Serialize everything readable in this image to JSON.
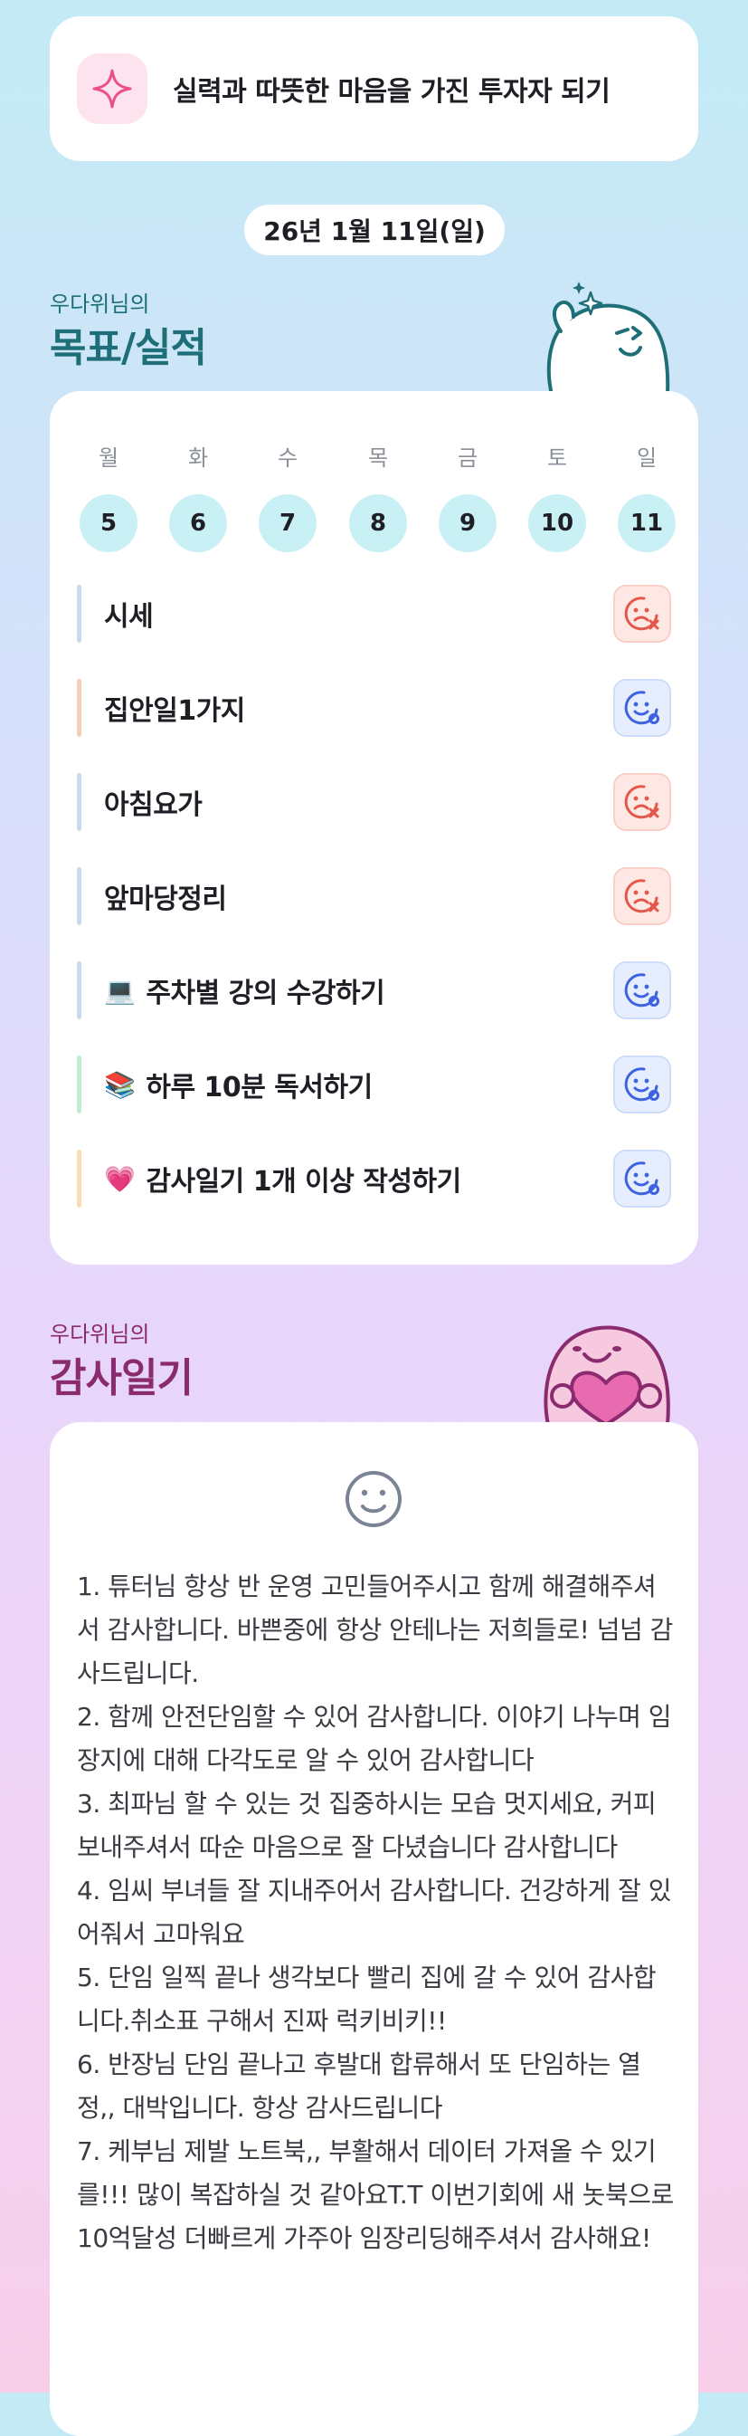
{
  "motto": {
    "icon": "sparkle-icon",
    "text": "실력과 따뜻한 마음을 가진 투자자 되기"
  },
  "date_label": "26년 1월 11일(일)",
  "goals_section": {
    "subtitle": "우다위님의",
    "title": "목표/실적",
    "weekdays": [
      "월",
      "화",
      "수",
      "목",
      "금",
      "토",
      "일"
    ],
    "days": [
      "5",
      "6",
      "7",
      "8",
      "9",
      "10",
      "11"
    ],
    "items": [
      {
        "label": "시세",
        "emoji": "",
        "status": "fail",
        "bar_color": "#c9d9ee"
      },
      {
        "label": "집안일1가지",
        "emoji": "",
        "status": "done",
        "bar_color": "#f6cdb8"
      },
      {
        "label": "아침요가",
        "emoji": "",
        "status": "fail",
        "bar_color": "#c9d9ee"
      },
      {
        "label": "앞마당정리",
        "emoji": "",
        "status": "fail",
        "bar_color": "#c9d9ee"
      },
      {
        "label": "주차별 강의 수강하기",
        "emoji": "💻",
        "status": "done",
        "bar_color": "#c9d9ee"
      },
      {
        "label": "하루 10분 독서하기",
        "emoji": "📚",
        "status": "done",
        "bar_color": "#bdeed4"
      },
      {
        "label": "감사일기 1개 이상 작성하기",
        "emoji": "💗",
        "status": "done",
        "bar_color": "#f9dcb6"
      }
    ]
  },
  "gratitude_section": {
    "subtitle": "우다위님의",
    "title": "감사일기",
    "icon": "smile-face-icon",
    "entries": [
      "1. 튜터님 항상 반 운영 고민들어주시고 함께 해결해주셔서 감사합니다. 바쁜중에 항상 안테나는 저희들로! 넘넘 감사드립니다.",
      "2. 함께 안전단임할 수 있어 감사합니다. 이야기 나누며 임장지에 대해 다각도로 알 수 있어 감사합니다",
      "3. 최파님 할 수 있는 것 집중하시는 모습 멋지세요, 커피보내주셔서 따순 마음으로 잘 다녔습니다 감사합니다",
      "4. 임씨 부녀들 잘 지내주어서 감사합니다. 건강하게 잘 있어줘서 고마워요",
      "5. 단임 일찍 끝나 생각보다 빨리 집에 갈 수 있어 감사합니다.취소표 구해서 진짜 럭키비키!!",
      "6. 반장님 단임 끝나고 후발대 합류해서 또 단임하는 열정,, 대박입니다. 항상 감사드립니다",
      "7. 케부님 제발 노트북,, 부활해서 데이터 가져올 수 있기를!!! 많이 복잡하실 것 같아요T.T 이번기회에 새 놋북으로 10억달성 더빠르게 가주아 임장리딩해주셔서 감사해요!"
    ]
  },
  "colors": {
    "fail_icon": "#e4574a",
    "done_icon": "#3d63e0",
    "day_circle": "#c8f0f5",
    "goals_title": "#1e6f78",
    "diary_title": "#8a2a6f"
  }
}
